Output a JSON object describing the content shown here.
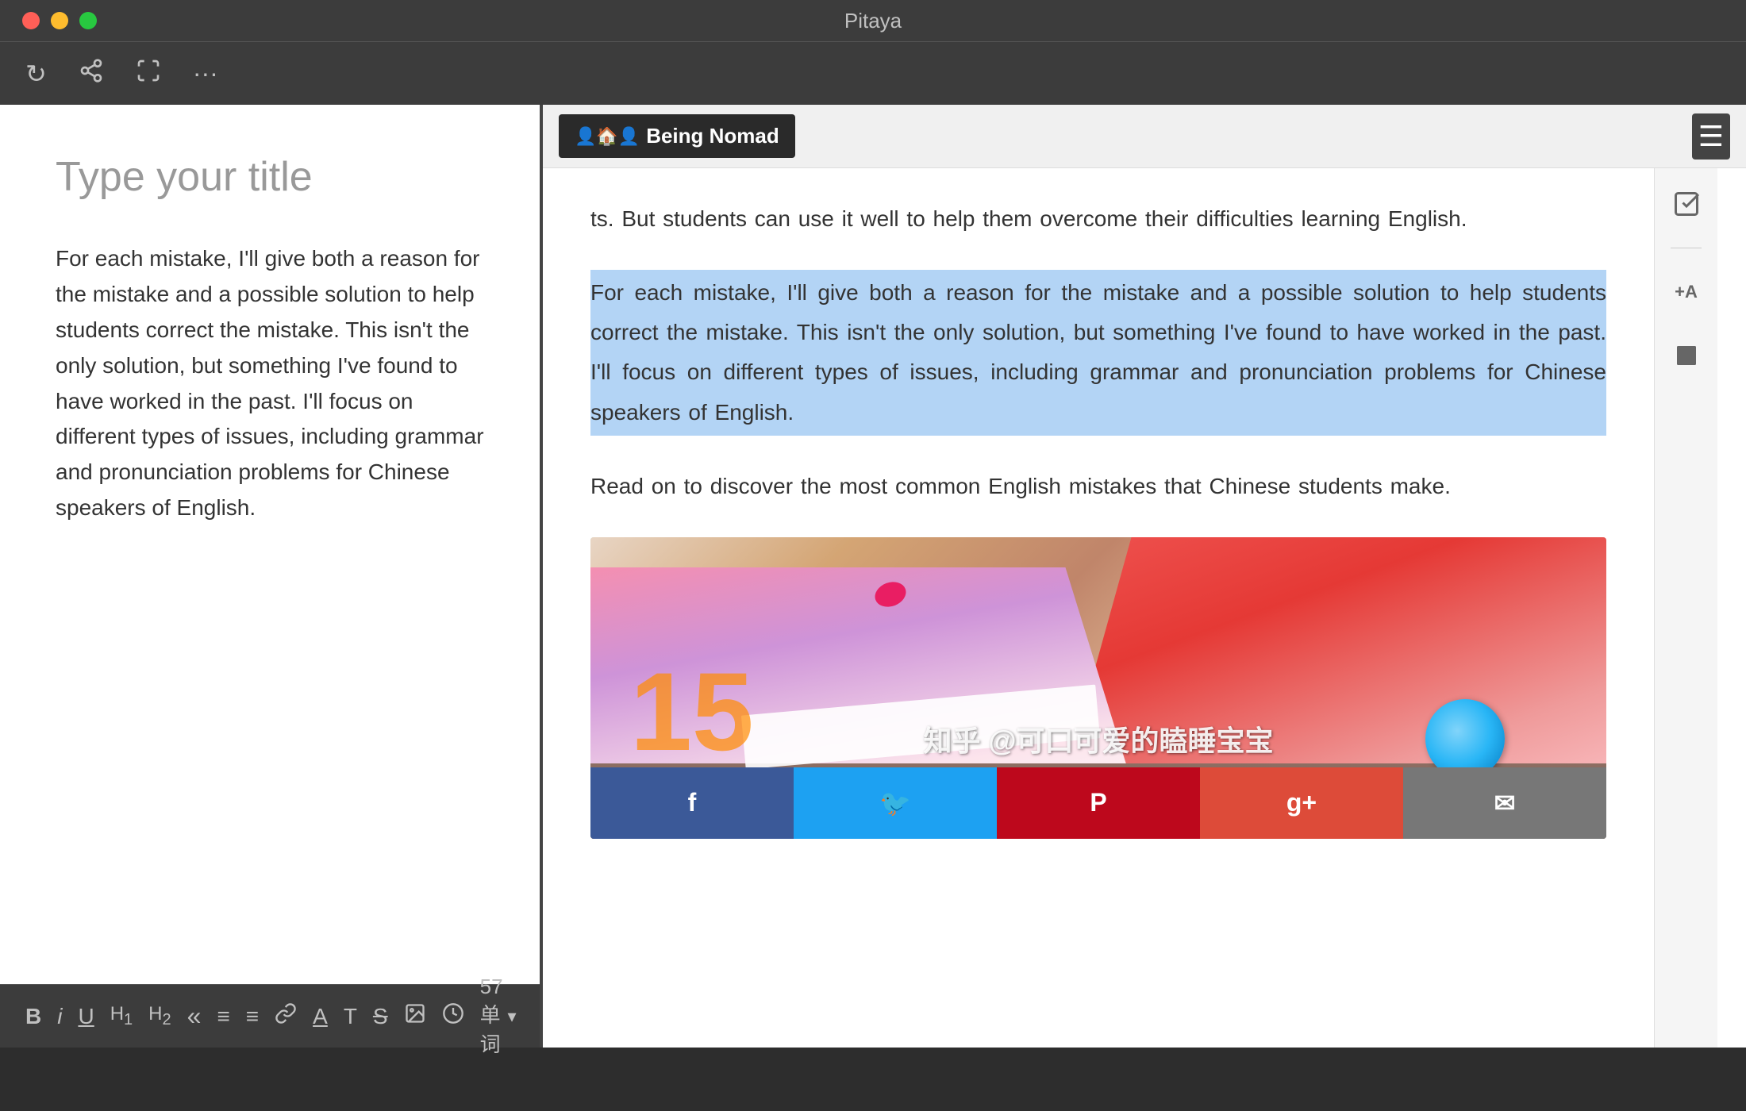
{
  "app": {
    "title": "Pitaya"
  },
  "title_bar": {
    "title": "Pitaya"
  },
  "traffic_lights": {
    "red": "close",
    "yellow": "minimize",
    "green": "maximize"
  },
  "toolbar": {
    "refresh_label": "↻",
    "share_label": "⎋",
    "fullscreen_label": "⤢",
    "more_label": "···"
  },
  "editor": {
    "title_placeholder": "Type your title",
    "body_text": "For each mistake, I'll give both a reason for the mistake and a possible solution to help students correct the mistake. This isn't the only solution, but something I've found to have worked in the past. I'll focus on different types of issues, including grammar and pronunciation problems for Chinese speakers of English."
  },
  "format_toolbar": {
    "bold": "B",
    "italic": "i",
    "underline": "U",
    "h1": "H₁",
    "h2": "H₂",
    "quote": "\"",
    "list_ul": "≡",
    "list_ol": "≡",
    "link": "🔗",
    "annotate": "A",
    "text_type": "T",
    "strikethrough": "S",
    "image": "⊞",
    "timer": "⊙",
    "word_count": "57 单词",
    "word_count_arrow": "▾"
  },
  "browser": {
    "logo_text": "Being Nomad",
    "logo_icon": "🏠",
    "menu_icon": "☰",
    "intro_text": "ts. But students can use it well to help them overcome their difficulties learning English.",
    "highlight_text": "For each mistake, I'll give both a reason for the mistake and a possible solution to help students correct the mistake. This isn't the only solution, but something I've found to have worked in the past. I'll focus on different types of issues, including grammar and pronunciation problems for Chinese speakers of English.",
    "read_on_text": "Read on to discover the most common English mistakes that Chinese students make.",
    "watermark": "知乎 @可口可爱的瞌睡宝宝",
    "number_overlay": "15",
    "social_buttons": [
      {
        "label": "f",
        "platform": "facebook"
      },
      {
        "label": "🐦",
        "platform": "twitter"
      },
      {
        "label": "P",
        "platform": "pinterest"
      },
      {
        "label": "g+",
        "platform": "google-plus"
      },
      {
        "label": "✉",
        "platform": "email"
      }
    ]
  },
  "sidebar": {
    "checkbox_icon": "✓",
    "formula_icon": "+A",
    "shape_icon": "⬟"
  }
}
